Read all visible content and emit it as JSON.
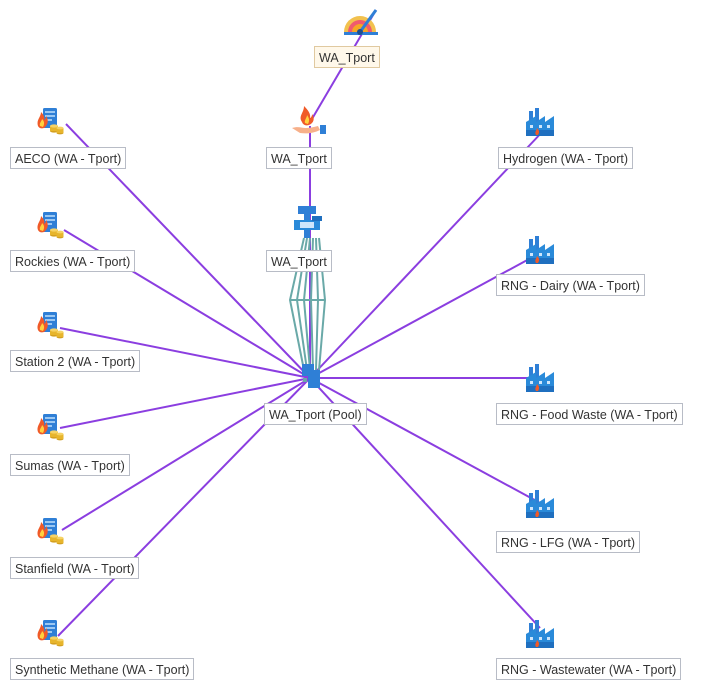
{
  "nodes": {
    "tport_top": "WA_Tport",
    "tport_demand": "WA_Tport",
    "tport_storage": "WA_Tport",
    "pool": "WA_Tport (Pool)",
    "aeco": "AECO (WA - Tport)",
    "rockies": "Rockies (WA - Tport)",
    "station2": "Station 2 (WA - Tport)",
    "sumas": "Sumas (WA - Tport)",
    "stanfield": "Stanfield (WA - Tport)",
    "synthetic": "Synthetic Methane (WA - Tport)",
    "hydrogen": "Hydrogen (WA - Tport)",
    "rng_dairy": "RNG - Dairy (WA - Tport)",
    "rng_food": "RNG - Food Waste (WA - Tport)",
    "rng_lfg": "RNG - LFG (WA - Tport)",
    "rng_wastewater": "RNG - Wastewater (WA - Tport)"
  },
  "colors": {
    "edge": "#8b3ee0",
    "pipe": "#6aa9a8",
    "label_border": "#b8bcc6",
    "label_selected_bg": "#fff8ea"
  },
  "icons": {
    "supply": "gas-supply-coins-icon",
    "plant": "factory-icon",
    "storage": "storage-valve-icon",
    "demand": "flame-hand-icon",
    "gauge": "gauge-icon"
  }
}
